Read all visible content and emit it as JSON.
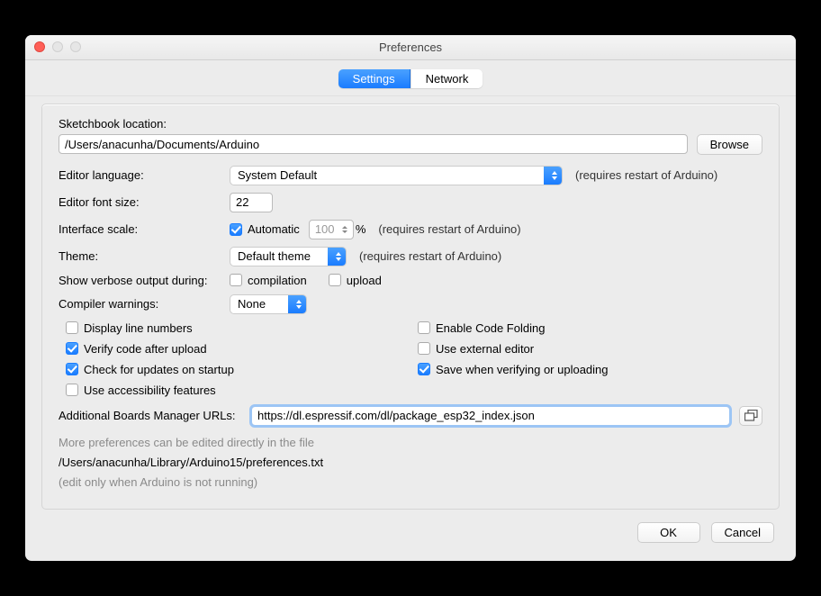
{
  "window": {
    "title": "Preferences"
  },
  "tabs": {
    "settings": "Settings",
    "network": "Network"
  },
  "labels": {
    "sketchbook": "Sketchbook location:",
    "editor_language": "Editor language:",
    "editor_font_size": "Editor font size:",
    "interface_scale": "Interface scale:",
    "theme": "Theme:",
    "verbose": "Show verbose output during:",
    "compiler_warnings": "Compiler warnings:",
    "additional_urls": "Additional Boards Manager URLs:"
  },
  "values": {
    "sketchbook_path": "/Users/anacunha/Documents/Arduino",
    "language": "System Default",
    "font_size": "22",
    "scale_percent": "100",
    "theme": "Default theme",
    "warnings": "None",
    "boards_url": "https://dl.espressif.com/dl/package_esp32_index.json",
    "prefs_path": "/Users/anacunha/Library/Arduino15/preferences.txt"
  },
  "hints": {
    "restart": "(requires restart of Arduino)",
    "percent": "%",
    "more_prefs": "More preferences can be edited directly in the file",
    "edit_only": "(edit only when Arduino is not running)"
  },
  "checkboxes": {
    "automatic": "Automatic",
    "compilation": "compilation",
    "upload": "upload",
    "display_line_numbers": "Display line numbers",
    "verify_after_upload": "Verify code after upload",
    "check_updates": "Check for updates on startup",
    "accessibility": "Use accessibility features",
    "code_folding": "Enable Code Folding",
    "external_editor": "Use external editor",
    "save_when_verify": "Save when verifying or uploading"
  },
  "buttons": {
    "browse": "Browse",
    "ok": "OK",
    "cancel": "Cancel"
  }
}
